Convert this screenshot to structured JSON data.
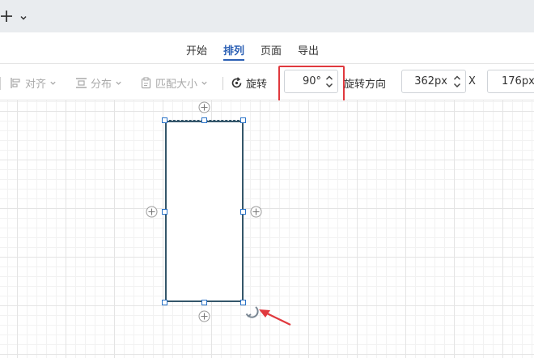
{
  "titlebar": {
    "add_icon": "plus-icon",
    "caret_icon": "chevron-down-icon"
  },
  "tabs": [
    {
      "label": "开始",
      "active": false
    },
    {
      "label": "排列",
      "active": true
    },
    {
      "label": "页面",
      "active": false
    },
    {
      "label": "导出",
      "active": false
    }
  ],
  "toolbar": {
    "align_label": "对齐",
    "distribute_label": "分布",
    "match_size_label": "匹配大小",
    "rotate_label": "旋转",
    "rotation_value": "90°",
    "rotation_dir_label": "旋转方向",
    "width_value": "362px",
    "x_label": "X",
    "x_value": "176px"
  },
  "colors": {
    "accent": "#2b5fb4",
    "highlight": "#e0393e",
    "shape_stroke": "#34566a",
    "handle": "#2b74c8"
  }
}
